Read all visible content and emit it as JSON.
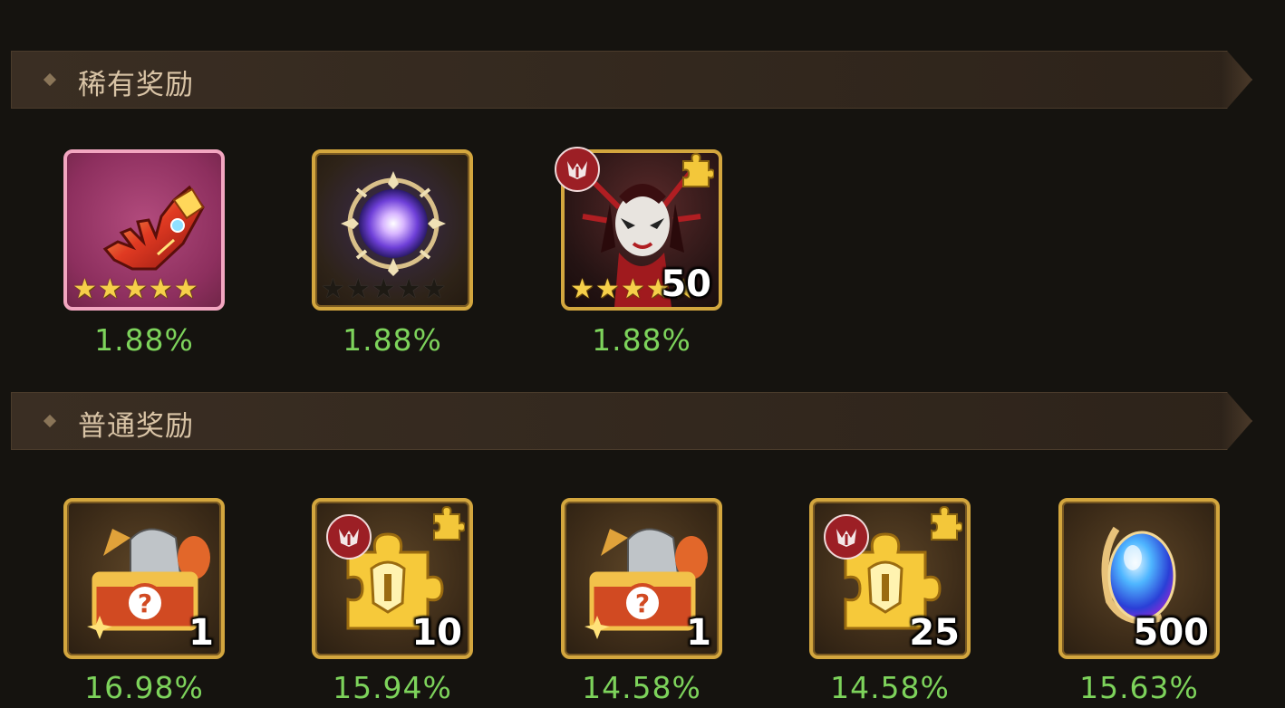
{
  "sections": [
    {
      "title": "稀有奖励",
      "items": [
        {
          "icon": "flame-gauntlet-icon",
          "frame": "pink",
          "stars_filled": 5,
          "stars_total": 5,
          "probability": "1.88%"
        },
        {
          "icon": "purple-orb-artifact-icon",
          "frame": "gold",
          "stars_filled": 0,
          "stars_total": 5,
          "probability": "1.88%"
        },
        {
          "icon": "masked-hero-portrait-icon",
          "frame": "dark",
          "stars_filled": 5,
          "stars_total": 5,
          "count": "50",
          "faction": "demon-faction-icon",
          "puzzle": true,
          "probability": "1.88%"
        }
      ]
    },
    {
      "title": "普通奖励",
      "items": [
        {
          "icon": "equipment-mystery-chest-icon",
          "count": "1",
          "probability": "16.98%"
        },
        {
          "icon": "hero-helmet-puzzle-piece-icon",
          "count": "10",
          "faction": "demon-faction-icon",
          "puzzle": true,
          "probability": "15.94%"
        },
        {
          "icon": "equipment-mystery-chest-icon",
          "count": "1",
          "probability": "14.58%"
        },
        {
          "icon": "hero-helmet-puzzle-piece-icon",
          "count": "25",
          "faction": "demon-faction-icon",
          "puzzle": true,
          "probability": "14.58%"
        },
        {
          "icon": "blue-crystal-gem-icon",
          "count": "500",
          "probability": "15.63%"
        }
      ]
    }
  ],
  "colors": {
    "accent_gold": "#d3a63e",
    "probability_green": "#7dd35b",
    "header_text": "#d9c4a6"
  }
}
